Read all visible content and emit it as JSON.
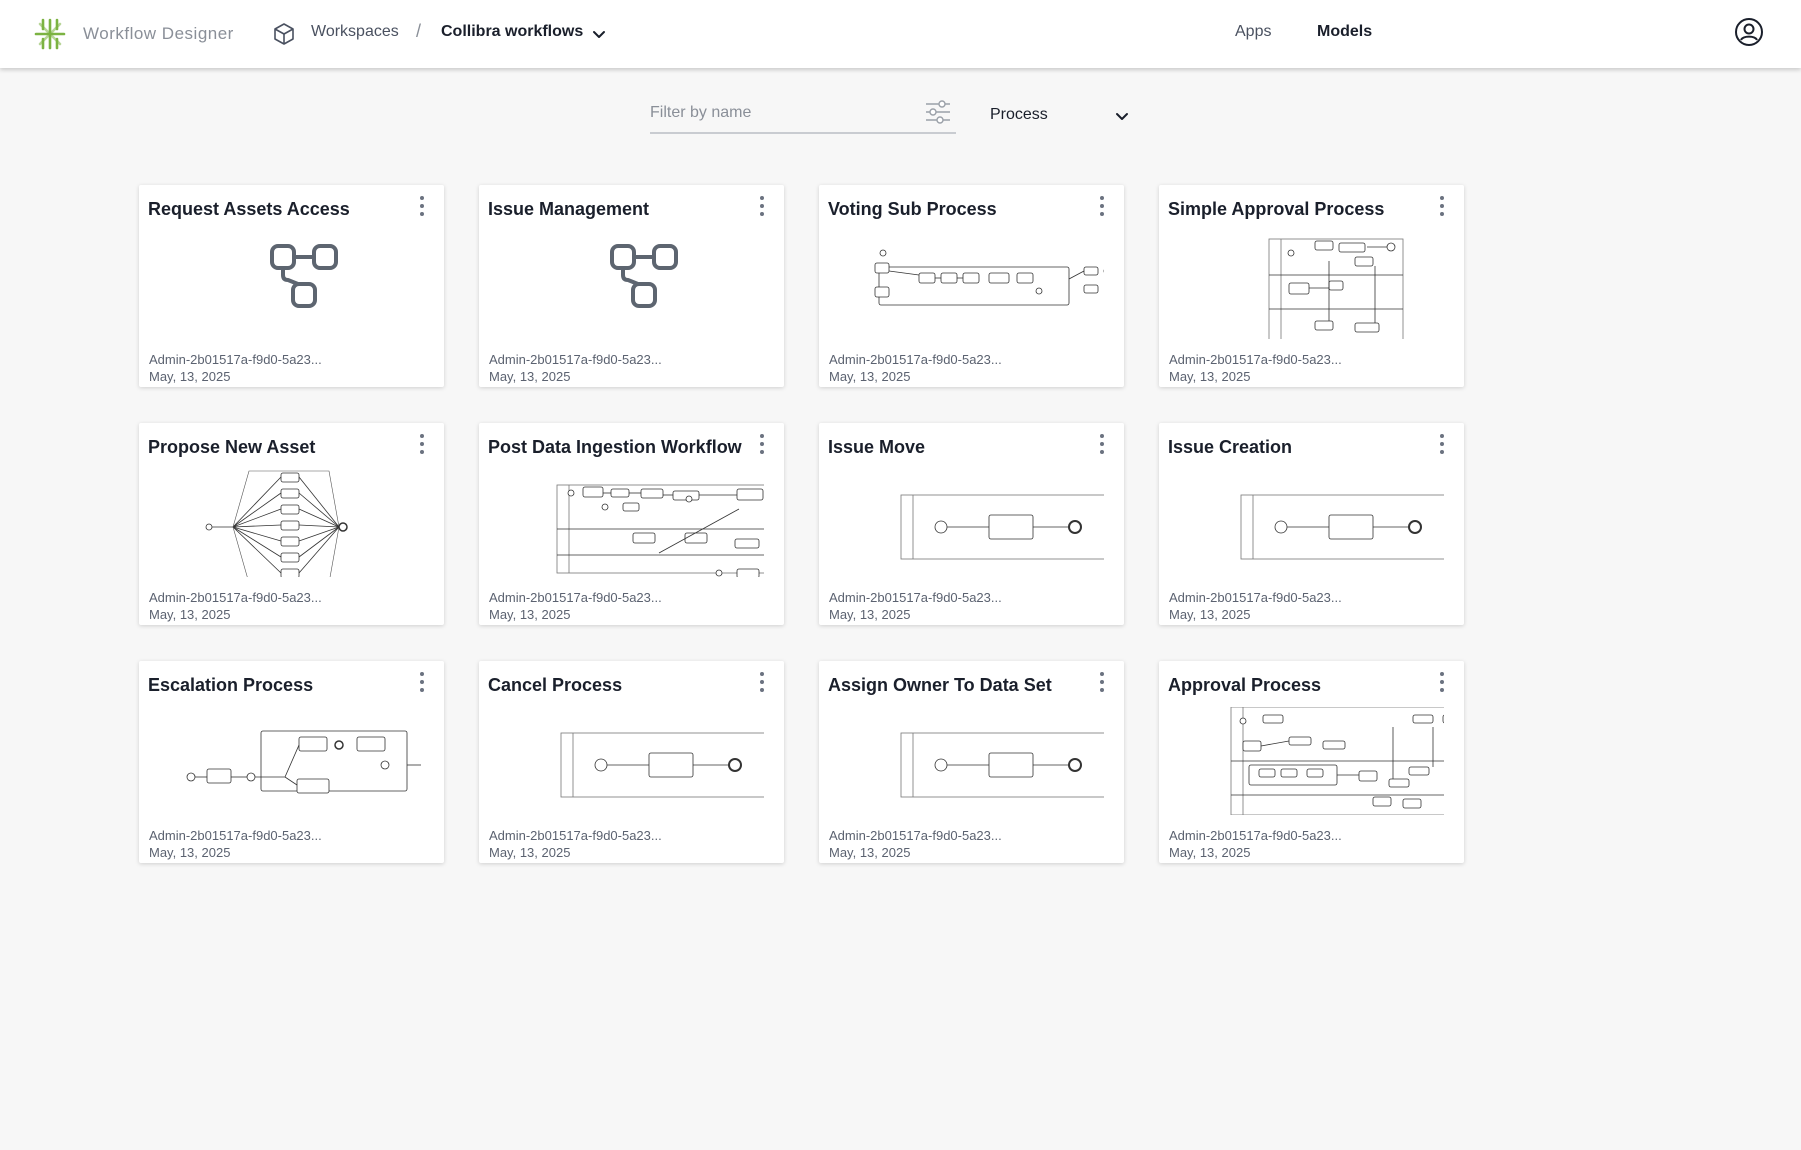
{
  "header": {
    "app_name": "Workflow Designer",
    "breadcrumb": {
      "workspaces": "Workspaces",
      "separator": "/",
      "current": "Collibra workflows"
    },
    "nav": {
      "apps": "Apps",
      "models": "Models"
    },
    "accent_color": "#7cb342"
  },
  "filters": {
    "search_placeholder": "Filter by name",
    "search_value": "",
    "type_selected": "Process"
  },
  "cards": [
    {
      "title": "Request Assets Access",
      "owner": "Admin-2b01517a-f9d0-5a23...",
      "date": "May, 13, 2025",
      "thumb": "model-icon"
    },
    {
      "title": "Issue Management",
      "owner": "Admin-2b01517a-f9d0-5a23...",
      "date": "May, 13, 2025",
      "thumb": "model-icon"
    },
    {
      "title": "Voting Sub Process",
      "owner": "Admin-2b01517a-f9d0-5a23...",
      "date": "May, 13, 2025",
      "thumb": "diagram-voting"
    },
    {
      "title": "Simple Approval Process",
      "owner": "Admin-2b01517a-f9d0-5a23...",
      "date": "May, 13, 2025",
      "thumb": "diagram-simple-approval"
    },
    {
      "title": "Propose New Asset",
      "owner": "Admin-2b01517a-f9d0-5a23...",
      "date": "May, 13, 2025",
      "thumb": "diagram-propose"
    },
    {
      "title": "Post Data Ingestion Workflow",
      "owner": "Admin-2b01517a-f9d0-5a23...",
      "date": "May, 13, 2025",
      "thumb": "diagram-post-ingestion"
    },
    {
      "title": "Issue Move",
      "owner": "Admin-2b01517a-f9d0-5a23...",
      "date": "May, 13, 2025",
      "thumb": "diagram-simple-lane"
    },
    {
      "title": "Issue Creation",
      "owner": "Admin-2b01517a-f9d0-5a23...",
      "date": "May, 13, 2025",
      "thumb": "diagram-simple-lane"
    },
    {
      "title": "Escalation Process",
      "owner": "Admin-2b01517a-f9d0-5a23...",
      "date": "May, 13, 2025",
      "thumb": "diagram-escalation"
    },
    {
      "title": "Cancel Process",
      "owner": "Admin-2b01517a-f9d0-5a23...",
      "date": "May, 13, 2025",
      "thumb": "diagram-simple-lane"
    },
    {
      "title": "Assign Owner To Data Set",
      "owner": "Admin-2b01517a-f9d0-5a23...",
      "date": "May, 13, 2025",
      "thumb": "diagram-simple-lane"
    },
    {
      "title": "Approval Process",
      "owner": "Admin-2b01517a-f9d0-5a23...",
      "date": "May, 13, 2025",
      "thumb": "diagram-approval"
    }
  ]
}
